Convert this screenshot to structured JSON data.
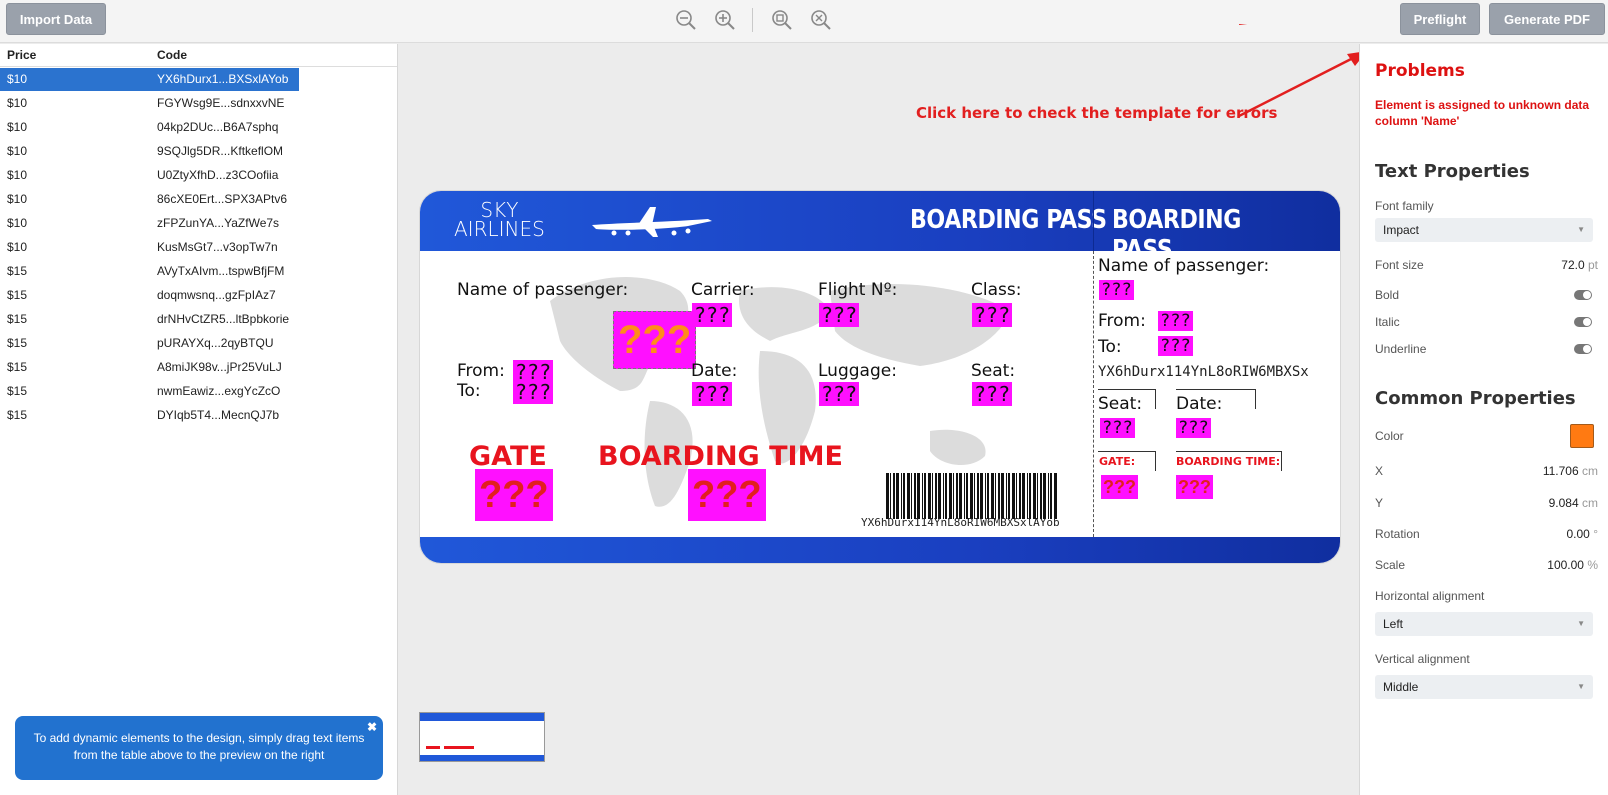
{
  "toolbar": {
    "import_label": "Import Data",
    "preflight_label": "Preflight",
    "generate_label": "Generate PDF"
  },
  "table": {
    "headers": [
      "Price",
      "Code"
    ],
    "rows": [
      [
        "$10",
        "YX6hDurx1...BXSxlAYob"
      ],
      [
        "$10",
        "FGYWsg9E...sdnxxvNE"
      ],
      [
        "$10",
        "04kp2DUc...B6A7sphq"
      ],
      [
        "$10",
        "9SQJlg5DR...KftkeflOM"
      ],
      [
        "$10",
        "U0ZtyXfhD...z3COofiia"
      ],
      [
        "$10",
        "86cXE0Ert...SPX3APtv6"
      ],
      [
        "$10",
        "zFPZunYA...YaZfWe7s"
      ],
      [
        "$10",
        "KusMsGt7...v3opTw7n"
      ],
      [
        "$15",
        "AVyTxAIvm...tspwBfjFM"
      ],
      [
        "$15",
        "doqmwsnq...gzFpIAz7"
      ],
      [
        "$15",
        "drNHvCtZR5...ltBpbkorie"
      ],
      [
        "$15",
        "pURAYXq...2qyBTQU"
      ],
      [
        "$15",
        "A8miJK98v...jPr25VuLJ"
      ],
      [
        "$15",
        "nwmEawiz...exgYcZcO"
      ],
      [
        "$15",
        "DYIqb5T4...MecnQJ7b"
      ]
    ]
  },
  "info_box": {
    "text": "To add dynamic elements to the design, simply drag text items from the table above to the preview on the right",
    "close": "✖"
  },
  "annotation": "Click here to check the template for errors",
  "ticket": {
    "airline_1": "SKY",
    "airline_2": "AIRLINES",
    "boarding_pass": "BOARDING PASS",
    "name_label": "Name of passenger:",
    "carrier_label": "Carrier:",
    "flight_label": "Flight Nº:",
    "class_label": "Class:",
    "from_label": "From:",
    "to_label": "To:",
    "date_label": "Date:",
    "luggage_label": "Luggage:",
    "seat_label": "Seat:",
    "gate_label": "GATE",
    "boarding_time_label": "BOARDING TIME",
    "gate_small": "GATE:",
    "boarding_time_small": "BOARDING TIME:",
    "placeholder": "???",
    "code_right": "YX6hDurx114YnL8oRIW6MBXSx",
    "code_barcode": "YX6hDurx114YnL8oRIW6MBXSxlAYob"
  },
  "right_panel": {
    "problems_title": "Problems",
    "problem_text": "Element is assigned to unknown data column 'Name'",
    "text_props_title": "Text Properties",
    "font_family_label": "Font family",
    "font_family_value": "Impact",
    "font_size_label": "Font size",
    "font_size_value": "72.0",
    "font_size_unit": "pt",
    "bold_label": "Bold",
    "italic_label": "Italic",
    "underline_label": "Underline",
    "common_title": "Common Properties",
    "color_label": "Color",
    "color_value": "#ff7a12",
    "x_label": "X",
    "x_value": "11.706",
    "y_label": "Y",
    "y_value": "9.084",
    "len_unit": "cm",
    "rotation_label": "Rotation",
    "rotation_value": "0.00",
    "rotation_unit": "°",
    "scale_label": "Scale",
    "scale_value": "100.00",
    "scale_unit": "%",
    "halign_label": "Horizontal alignment",
    "halign_value": "Left",
    "valign_label": "Vertical alignment",
    "valign_value": "Middle"
  },
  "icons": [
    "zoom-out-icon",
    "zoom-in-icon",
    "zoom-fit-icon",
    "zoom-reset-icon",
    "close-icon",
    "plane-icon",
    "world-map-icon",
    "barcode-icon"
  ]
}
